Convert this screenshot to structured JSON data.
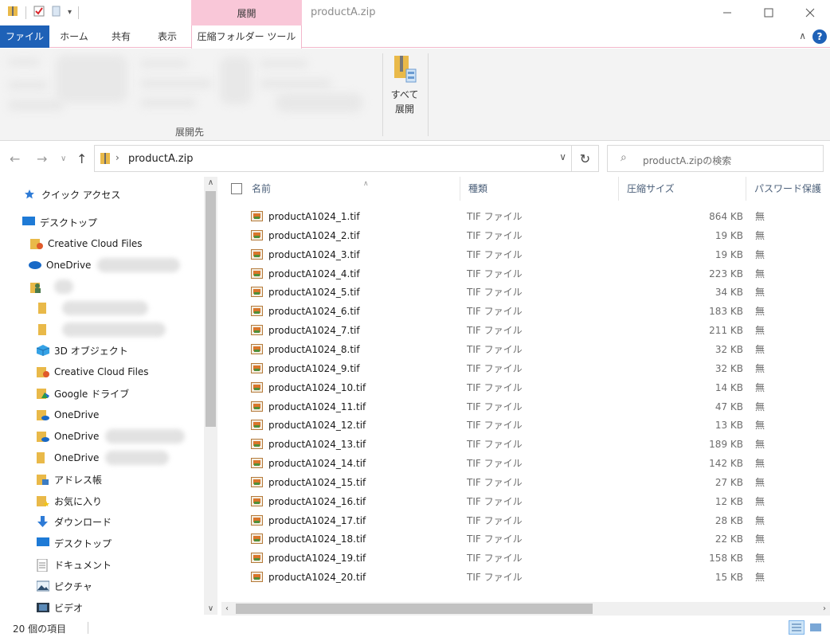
{
  "window": {
    "title": "productA.zip",
    "contextual_tab_group": "展開"
  },
  "ribbon_tabs": {
    "file": "ファイル",
    "home": "ホーム",
    "share": "共有",
    "view": "表示",
    "compressed_tools": "圧縮フォルダー ツール"
  },
  "ribbon": {
    "extract_to_caption": "展開先",
    "extract_all_line1": "すべて",
    "extract_all_line2": "展開"
  },
  "address": {
    "path": "productA.zip",
    "search_placeholder": "productA.zipの検索"
  },
  "nav_pane": {
    "quick_access": "クイック アクセス",
    "desktop_root": "デスクトップ",
    "cc_files_1": "Creative Cloud Files",
    "onedrive_1": "OneDrive",
    "user_folder": "",
    "blur_folder_1": "",
    "blur_folder_2": "",
    "objects_3d": "3D オブジェクト",
    "cc_files_2": "Creative Cloud Files",
    "google_drive": "Google ドライブ",
    "onedrive_2": "OneDrive",
    "onedrive_3": "OneDrive",
    "onedrive_4": "OneDrive",
    "address_book": "アドレス帳",
    "favorites": "お気に入り",
    "downloads": "ダウンロード",
    "desktop": "デスクトップ",
    "documents": "ドキュメント",
    "pictures": "ピクチャ",
    "videos": "ビデオ"
  },
  "columns": {
    "name": "名前",
    "type": "種類",
    "compressed_size": "圧縮サイズ",
    "password": "パスワード保護"
  },
  "files": [
    {
      "name": "productA1024_1.tif",
      "type": "TIF ファイル",
      "size": "864 KB",
      "password": "無"
    },
    {
      "name": "productA1024_2.tif",
      "type": "TIF ファイル",
      "size": "19 KB",
      "password": "無"
    },
    {
      "name": "productA1024_3.tif",
      "type": "TIF ファイル",
      "size": "19 KB",
      "password": "無"
    },
    {
      "name": "productA1024_4.tif",
      "type": "TIF ファイル",
      "size": "223 KB",
      "password": "無"
    },
    {
      "name": "productA1024_5.tif",
      "type": "TIF ファイル",
      "size": "34 KB",
      "password": "無"
    },
    {
      "name": "productA1024_6.tif",
      "type": "TIF ファイル",
      "size": "183 KB",
      "password": "無"
    },
    {
      "name": "productA1024_7.tif",
      "type": "TIF ファイル",
      "size": "211 KB",
      "password": "無"
    },
    {
      "name": "productA1024_8.tif",
      "type": "TIF ファイル",
      "size": "32 KB",
      "password": "無"
    },
    {
      "name": "productA1024_9.tif",
      "type": "TIF ファイル",
      "size": "32 KB",
      "password": "無"
    },
    {
      "name": "productA1024_10.tif",
      "type": "TIF ファイル",
      "size": "14 KB",
      "password": "無"
    },
    {
      "name": "productA1024_11.tif",
      "type": "TIF ファイル",
      "size": "47 KB",
      "password": "無"
    },
    {
      "name": "productA1024_12.tif",
      "type": "TIF ファイル",
      "size": "13 KB",
      "password": "無"
    },
    {
      "name": "productA1024_13.tif",
      "type": "TIF ファイル",
      "size": "189 KB",
      "password": "無"
    },
    {
      "name": "productA1024_14.tif",
      "type": "TIF ファイル",
      "size": "142 KB",
      "password": "無"
    },
    {
      "name": "productA1024_15.tif",
      "type": "TIF ファイル",
      "size": "27 KB",
      "password": "無"
    },
    {
      "name": "productA1024_16.tif",
      "type": "TIF ファイル",
      "size": "12 KB",
      "password": "無"
    },
    {
      "name": "productA1024_17.tif",
      "type": "TIF ファイル",
      "size": "28 KB",
      "password": "無"
    },
    {
      "name": "productA1024_18.tif",
      "type": "TIF ファイル",
      "size": "22 KB",
      "password": "無"
    },
    {
      "name": "productA1024_19.tif",
      "type": "TIF ファイル",
      "size": "158 KB",
      "password": "無"
    },
    {
      "name": "productA1024_20.tif",
      "type": "TIF ファイル",
      "size": "15 KB",
      "password": "無"
    }
  ],
  "status": {
    "item_count": "20 個の項目"
  },
  "colors": {
    "file_tab": "#1e61b7",
    "contextual_tab": "#f9c7d8",
    "header_text": "#4c607a"
  }
}
